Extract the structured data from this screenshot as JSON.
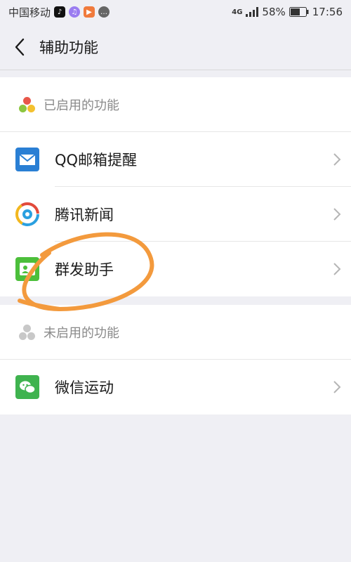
{
  "status_bar": {
    "carrier": "中国移动",
    "network": "4G",
    "battery": "58%",
    "time": "17:56"
  },
  "nav": {
    "title": "辅助功能"
  },
  "enabled_section": {
    "header": "已启用的功能",
    "items": [
      {
        "label": "QQ邮箱提醒"
      },
      {
        "label": "腾讯新闻"
      },
      {
        "label": "群发助手"
      }
    ]
  },
  "disabled_section": {
    "header": "未启用的功能",
    "items": [
      {
        "label": "微信运动"
      }
    ]
  },
  "colors": {
    "accent_annotation": "#f39a3d",
    "qq_mail_blue": "#2a7fd4",
    "mass_send_green": "#4cbf3b",
    "wechat_sport_green": "#3fb34f"
  }
}
